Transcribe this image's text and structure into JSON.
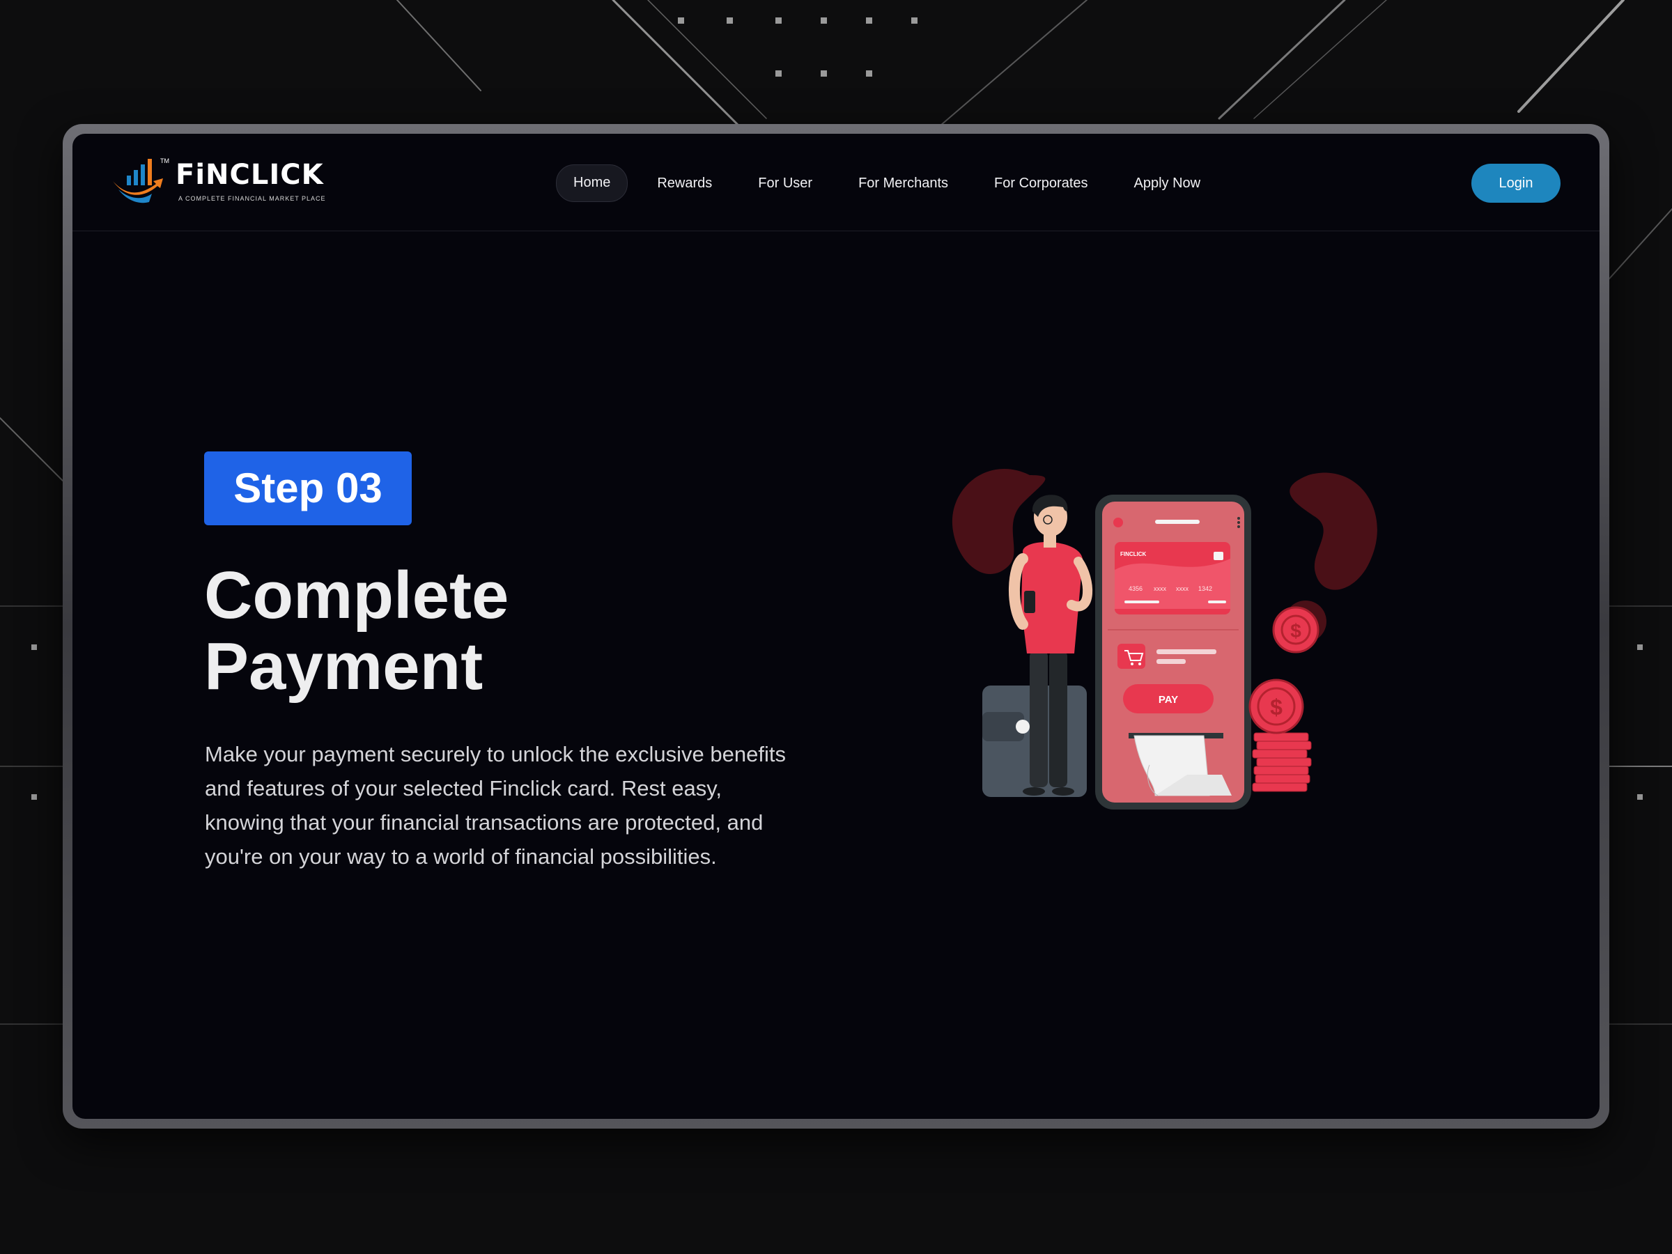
{
  "brand": {
    "name": "FiNCLICK",
    "tagline": "A COMPLETE FINANCIAL MARKET PLACE",
    "trademark": "TM"
  },
  "nav": {
    "items": [
      "Home",
      "Rewards",
      "For User",
      "For Merchants",
      "For Corporates",
      "Apply Now"
    ],
    "active": "Home",
    "login_label": "Login"
  },
  "hero": {
    "step_label": "Step 03",
    "title_line1": "Complete",
    "title_line2": "Payment",
    "description": "Make your payment securely to unlock the exclusive benefits and features of your selected Finclick card. Rest easy, knowing that your financial transactions are protected, and you're on your way to a world of financial possibilities."
  },
  "illustration": {
    "card_brand": "FINCLICK",
    "card_number_parts": [
      "4356",
      "xxxx",
      "xxxx",
      "1342"
    ],
    "pay_label": "PAY",
    "currency_symbol": "$"
  },
  "colors": {
    "accent_blue": "#1f63e7",
    "login_blue": "#1e86be",
    "illustration_red": "#e8384f",
    "page_bg": "#05050c"
  }
}
